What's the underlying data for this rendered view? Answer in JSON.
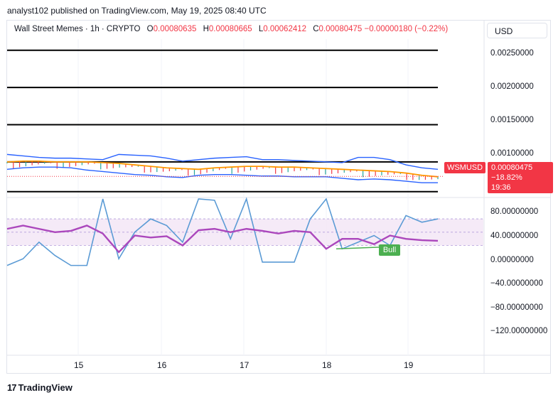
{
  "header": {
    "publisher": "analyst102 published on TradingView.com, May 19, 2025 08:40 UTC"
  },
  "legend": {
    "symbol": "Wall Street Memes · 1h · CRYPTO",
    "o_label": "O",
    "o_value": "0.00080635",
    "h_label": "H",
    "h_value": "0.00080665",
    "l_label": "L",
    "l_value": "0.00062412",
    "c_label": "C",
    "c_value": "0.00080475",
    "change": "−0.00000180 (−0.22%)"
  },
  "currency": "USD",
  "price_axis": [
    "0.00250000",
    "0.00200000",
    "0.00150000",
    "0.00100000"
  ],
  "osc_axis": [
    "80.00000000",
    "40.00000000",
    "0.00000000",
    "−40.00000000",
    "−80.00000000",
    "−120.00000000"
  ],
  "price_tag": {
    "symbol": "WSMUSD",
    "price": "0.00080475",
    "change": "−18.82%",
    "countdown": "19:36"
  },
  "bull_label": "Bull",
  "brand": {
    "logo": "17",
    "name": "TradingView"
  },
  "colors": {
    "up": "#26a69a",
    "down": "#f23645",
    "bb": "#2962ff",
    "ma": "#ff9800",
    "rsi": "#ab47bc",
    "stoch": "#5b9bd5"
  },
  "chart_data": [
    {
      "type": "line",
      "title": "",
      "x_labels": [
        "15",
        "16",
        "17",
        "18",
        "19"
      ],
      "ylim": [
        0.00055,
        0.00265
      ],
      "yticks": [
        0.0025,
        0.002,
        0.0015,
        0.001
      ],
      "horizontal_levels": [
        0.0025,
        0.002,
        0.0015,
        0.001,
        0.0006
      ],
      "series": [
        {
          "values": [
            0.0011,
            0.00108,
            0.00106,
            0.00105,
            0.00105,
            0.00104,
            0.00103,
            0.0011,
            0.00109,
            0.00108,
            0.00105,
            0.00101,
            0.00103,
            0.00105,
            0.00106,
            0.00107,
            0.00103,
            0.00103,
            0.00102,
            0.00101,
            0.001,
            0.00099,
            0.00106,
            0.00106,
            0.00103,
            0.00096,
            0.00092,
            0.0009
          ]
        },
        {
          "values": [
            0.001,
            0.00101,
            0.00101,
            0.001,
            0.001,
            0.001,
            0.00099,
            0.00098,
            0.00096,
            0.00094,
            0.00092,
            0.00091,
            0.0009,
            0.00092,
            0.00093,
            0.00094,
            0.00094,
            0.00093,
            0.00093,
            0.00092,
            0.00091,
            0.0009,
            0.00089,
            0.00088,
            0.00087,
            0.00085,
            0.00082,
            0.0008
          ]
        },
        {
          "values": [
            0.0009,
            0.00092,
            0.00093,
            0.00093,
            0.00092,
            0.00089,
            0.00087,
            0.00085,
            0.00083,
            0.00082,
            0.0008,
            0.00079,
            0.00082,
            0.00083,
            0.00083,
            0.00082,
            0.00081,
            0.00081,
            0.0008,
            0.0008,
            0.0008,
            0.00078,
            0.00076,
            0.00077,
            0.00076,
            0.00074,
            0.00072,
            0.00072
          ]
        }
      ]
    },
    {
      "type": "line",
      "title": "",
      "ylim": [
        -135,
        100
      ],
      "yticks": [
        80,
        40,
        0,
        -40,
        -80,
        -120
      ],
      "series": [
        {
          "values": [
            55,
            60,
            55,
            50,
            52,
            60,
            48,
            20,
            45,
            42,
            44,
            30,
            53,
            55,
            50,
            55,
            52,
            48,
            52,
            50,
            25,
            40,
            40,
            32,
            45,
            40,
            38,
            37
          ]
        },
        {
          "values": [
            0,
            10,
            35,
            15,
            0,
            0,
            100,
            10,
            50,
            70,
            60,
            35,
            100,
            98,
            40,
            100,
            5,
            5,
            5,
            70,
            100,
            25,
            35,
            45,
            30,
            75,
            65,
            70
          ]
        }
      ]
    }
  ]
}
